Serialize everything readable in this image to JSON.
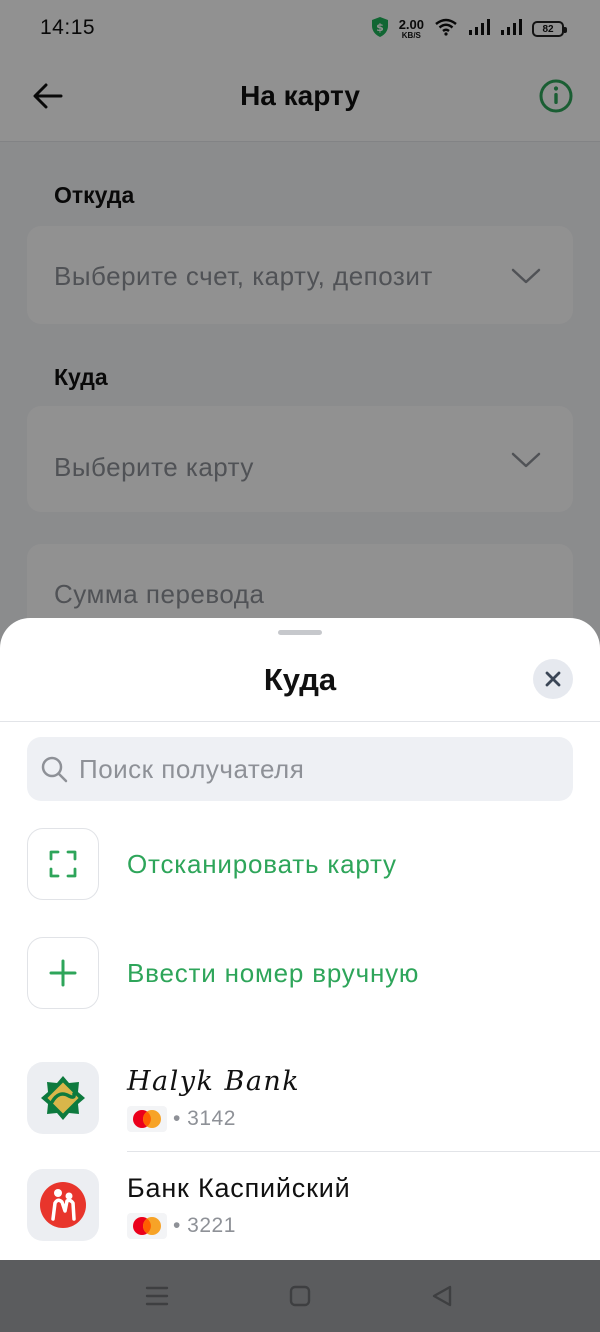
{
  "status_bar": {
    "time": "14:15",
    "net_speed_value": "2.00",
    "net_speed_unit": "KB/S",
    "battery": "82",
    "icons": [
      "vpn-shield-icon",
      "wifi-icon",
      "signal-icon",
      "signal-icon",
      "battery-icon"
    ]
  },
  "header": {
    "title": "На карту",
    "back_icon": "arrow-left-icon",
    "info_icon": "info-icon",
    "accent_color": "#2ea55a"
  },
  "form": {
    "from_label": "Откуда",
    "from_placeholder": "Выберите счет, карту, депозит",
    "to_label": "Куда",
    "to_placeholder": "Выберите карту",
    "amount_placeholder": "Сумма перевода"
  },
  "sheet": {
    "title": "Куда",
    "close_icon": "close-icon",
    "search_placeholder": "Поиск получателя",
    "actions": [
      {
        "label": "Отсканировать карту",
        "icon": "scan-frame-icon"
      },
      {
        "label": "Ввести номер вручную",
        "icon": "plus-icon"
      }
    ],
    "cards": [
      {
        "bank": "Halyk Bank",
        "network": "mastercard-icon",
        "number": "• 3142"
      },
      {
        "bank": "Банк Каспийский",
        "network": "mastercard-icon",
        "number": "• 3221"
      }
    ]
  },
  "nav_bar": {
    "buttons": [
      "menu-icon",
      "home-icon",
      "back-triangle-icon"
    ]
  }
}
